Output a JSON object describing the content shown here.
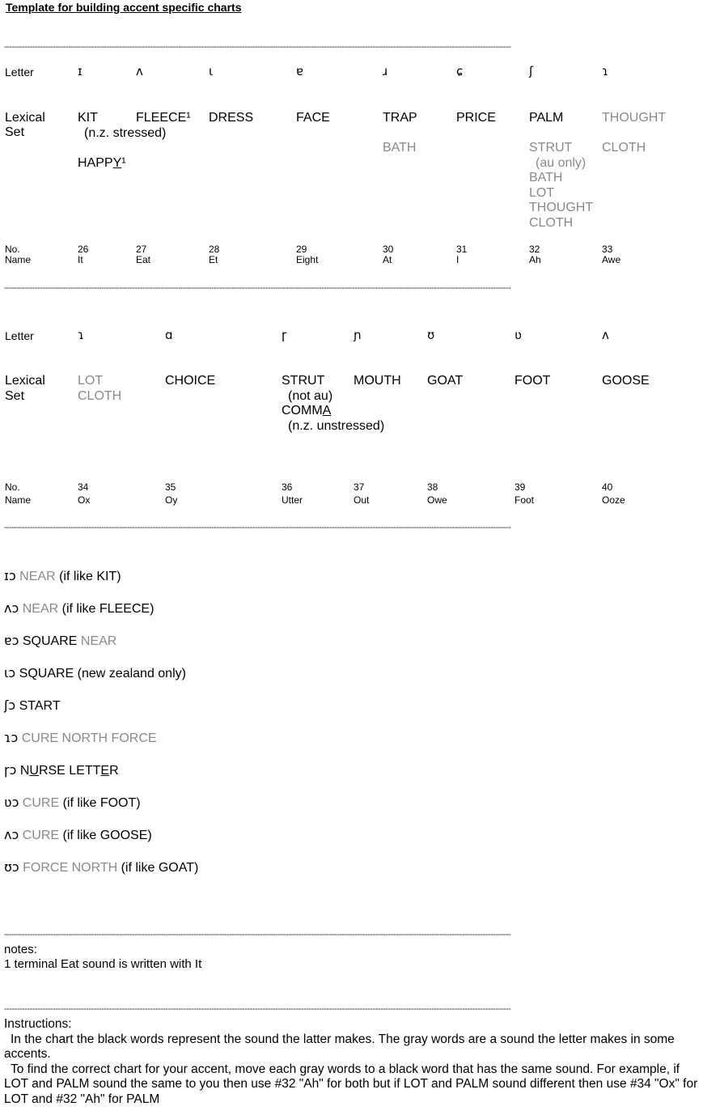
{
  "title": "Template for building accent specific charts",
  "dashes": "------------------------------------------------------------------------------------------------------------------------------------------------------------------------------------------------------",
  "labels": {
    "letter": "Letter",
    "lexical": "Lexical",
    "set": "Set",
    "no": "No.",
    "name": "Name"
  },
  "table1": {
    "letters": [
      "ɪ",
      "ʌ",
      "ɩ",
      "ɐ",
      "ɹ",
      "ɕ",
      "ʃ",
      "ɿ"
    ],
    "lexical": [
      [
        {
          "t": "KIT",
          "g": false
        },
        {
          "t": "(n.z. stressed)",
          "g": false,
          "sub": true
        },
        {
          "t": "",
          "g": false
        },
        {
          "t": "HAPPY¹",
          "g": false,
          "ul": "Y"
        }
      ],
      [
        {
          "t": "FLEECE¹",
          "g": false
        }
      ],
      [
        {
          "t": "DRESS",
          "g": false
        }
      ],
      [
        {
          "t": "FACE",
          "g": false
        }
      ],
      [
        {
          "t": "TRAP",
          "g": false
        },
        {
          "t": "",
          "g": false
        },
        {
          "t": "BATH",
          "g": true
        }
      ],
      [
        {
          "t": "PRICE",
          "g": false
        }
      ],
      [
        {
          "t": "PALM",
          "g": false
        },
        {
          "t": "",
          "g": false
        },
        {
          "t": "STRUT",
          "g": true
        },
        {
          "t": "(au only)",
          "g": true,
          "sub": true
        },
        {
          "t": "BATH",
          "g": true
        },
        {
          "t": "LOT",
          "g": true
        },
        {
          "t": "THOUGHT",
          "g": true
        },
        {
          "t": "CLOTH",
          "g": true
        }
      ],
      [
        {
          "t": "THOUGHT",
          "g": true
        },
        {
          "t": "",
          "g": false
        },
        {
          "t": "CLOTH",
          "g": true
        }
      ]
    ],
    "numbers": [
      "26",
      "27",
      "28",
      "29",
      "30",
      "31",
      "32",
      "33"
    ],
    "names": [
      "It",
      "Eat",
      "Et",
      "Eight",
      "At",
      "I",
      "Ah",
      "Awe"
    ]
  },
  "table2": {
    "letters": [
      "ɿ",
      "ɑ",
      "ɼ",
      "ɲ",
      "ʊ",
      "ʋ",
      "ʌ"
    ],
    "lexical": [
      [
        {
          "t": "LOT",
          "g": true
        },
        {
          "t": "CLOTH",
          "g": true
        }
      ],
      [
        {
          "t": "CHOICE",
          "g": false
        }
      ],
      [
        {
          "t": "STRUT",
          "g": false
        },
        {
          "t": "(not au)",
          "g": false,
          "sub": true
        },
        {
          "t": "COMMA",
          "g": false,
          "ul": "A"
        },
        {
          "t": "(n.z. unstressed)",
          "g": false,
          "sub": true
        }
      ],
      [
        {
          "t": "MOUTH",
          "g": false
        }
      ],
      [
        {
          "t": "GOAT",
          "g": false
        }
      ],
      [
        {
          "t": "FOOT",
          "g": false
        }
      ],
      [
        {
          "t": "GOOSE",
          "g": false
        }
      ]
    ],
    "numbers": [
      "34",
      "35",
      "36",
      "37",
      "38",
      "39",
      "40"
    ],
    "names": [
      "Ox",
      "Oy",
      "Utter",
      "Out",
      "Owe",
      "Foot",
      "Ooze"
    ]
  },
  "rhotic": [
    [
      {
        "t": "ɪɔ",
        "k": "glyph"
      },
      {
        "t": " NEAR",
        "k": "gray"
      },
      {
        "t": "  (if like KIT)",
        "k": "black"
      }
    ],
    [
      {
        "t": "ʌɔ",
        "k": "glyph"
      },
      {
        "t": " NEAR",
        "k": "gray"
      },
      {
        "t": "  (if like FLEECE)",
        "k": "black"
      }
    ],
    [
      {
        "t": "ɐɔ",
        "k": "glyph"
      },
      {
        "t": " SQUARE",
        "k": "black"
      },
      {
        "t": " NEAR",
        "k": "gray"
      }
    ],
    [
      {
        "t": "ɩɔ",
        "k": "glyph"
      },
      {
        "t": " SQUARE",
        "k": "black"
      },
      {
        "t": " (new zealand only)",
        "k": "black"
      }
    ],
    [
      {
        "t": "ʃɔ",
        "k": "glyph"
      },
      {
        "t": " START",
        "k": "black"
      }
    ],
    [
      {
        "t": "ɿɔ",
        "k": "glyph"
      },
      {
        "t": "  CURE",
        "k": "gray"
      },
      {
        "t": " NORTH",
        "k": "gray"
      },
      {
        "t": "  FORCE",
        "k": "gray"
      }
    ],
    [
      {
        "t": "ɼɔ",
        "k": "glyph"
      },
      {
        "t": " N",
        "k": "black"
      },
      {
        "t": "U",
        "k": "ul"
      },
      {
        "t": "RSE LETT",
        "k": "black"
      },
      {
        "t": "E",
        "k": "ul"
      },
      {
        "t": "R",
        "k": "black"
      }
    ],
    [
      {
        "t": "ʋɔ",
        "k": "glyph"
      },
      {
        "t": "  CURE",
        "k": "gray"
      },
      {
        "t": "  (if like FOOT)",
        "k": "black"
      }
    ],
    [
      {
        "t": "ʌɔ",
        "k": "glyph"
      },
      {
        "t": "  CURE",
        "k": "gray"
      },
      {
        "t": "  (if like GOOSE)",
        "k": "black"
      }
    ],
    [
      {
        "t": "ʊɔ",
        "k": "glyph"
      },
      {
        "t": "  FORCE  NORTH",
        "k": "gray"
      },
      {
        "t": " (if like GOAT)",
        "k": "black"
      }
    ]
  ],
  "notes": {
    "heading": "notes:",
    "line1": "1 terminal Eat sound is written with It"
  },
  "instructions": {
    "heading": "Instructions:",
    "p1": "In the chart the black words represent the sound the latter makes. The gray words are a sound the letter makes in some accents.",
    "p2": "To find the correct chart for your accent, move each gray words to a black word that has the same sound. For example, if LOT and PALM sound the same to you then use #32 \"Ah\" for both but if LOT and PALM sound different then use #34 \"Ox\" for LOT and #32 \"Ah\" for PALM"
  }
}
